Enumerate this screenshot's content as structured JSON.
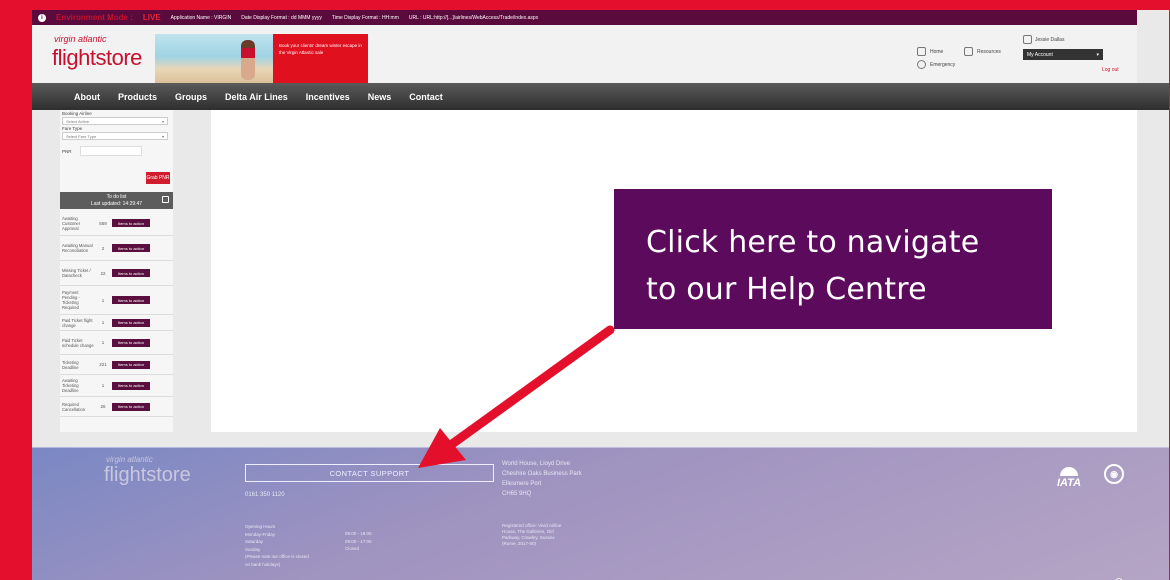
{
  "env_bar": {
    "mode": "Environment Mode :",
    "live": "LIVE",
    "app_name": "Application Name : VIRGIN",
    "date_format": "Date Display Format : dd MMM yyyy",
    "time_format": "Time Display Format : HH:mm",
    "url": "URL : URL:http://[...]/airlines/WebAccess/Trade/index.aspx"
  },
  "header": {
    "logo_small": "virgin atlantic",
    "logo_main": "flightstore",
    "banner_text": "Book your clients' dream winter escape in the Virgin Atlantic sale",
    "home": "Home",
    "resources": "Resources",
    "emergency": "Emergency",
    "user_name": "Jessie Dallas",
    "my_account": "My Account",
    "logout": "Log out"
  },
  "nav": {
    "items": [
      "About",
      "Products",
      "Groups",
      "Delta Air Lines",
      "Incentives",
      "News",
      "Contact"
    ]
  },
  "sidebar": {
    "booking_airline_label": "Booking Airline",
    "booking_airline_value": "Select Airline",
    "fare_type_label": "Fare Type",
    "fare_type_value": "Select Fare Type",
    "pnr_label": "PNR",
    "grab_pnr": "Grab PNR",
    "todo_title": "To do list",
    "todo_updated": "Last updated: 14:29:47",
    "todo_items": [
      {
        "name": "Awaiting Customer Approval",
        "count": "559",
        "action": "Items to action"
      },
      {
        "name": "Awaiting Manual Reconciliation",
        "count": "2",
        "action": "Items to action"
      },
      {
        "name": "Missing Ticket / Datacheck",
        "count": "22",
        "action": "Items to action"
      },
      {
        "name": "Payment Pending - Ticketing Required",
        "count": "1",
        "action": "Items to action"
      },
      {
        "name": "Paid Ticket flight change",
        "count": "1",
        "action": "Items to action"
      },
      {
        "name": "Paid Ticket schedule change",
        "count": "1",
        "action": "Items to action"
      },
      {
        "name": "Ticketing Deadline",
        "count": "221",
        "action": "Items to action"
      },
      {
        "name": "Awaiting Ticketing Deadline",
        "count": "1",
        "action": "Items to action"
      },
      {
        "name": "Required Cancellation",
        "count": "26",
        "action": "Items to action"
      }
    ]
  },
  "callout": {
    "line1": "Click here to navigate",
    "line2": "to our Help Centre"
  },
  "footer": {
    "logo_small": "virgin atlantic",
    "logo_main": "flightstore",
    "contact_support": "CONTACT SUPPORT",
    "phone": "0161 350 1120",
    "address_lines": [
      "World House, Lloyd Drive",
      "Cheshire Oaks Business Park",
      "Ellesmere Port",
      "CH65 9HQ"
    ],
    "hours_lines": [
      "Opening Hours",
      "Monday-Friday",
      "Saturday",
      "Sunday",
      "(Please note our office is closed",
      "on bank holidays)"
    ],
    "hours_times": [
      "09:00 - 18:00",
      "09:00 - 17:00",
      "Closed"
    ],
    "office_lines": [
      "Registered office: Vivid Airline",
      "House, The Galleries, Old",
      "Parkway, Crawley, Sussex",
      "(Rome, 2017-50)"
    ],
    "iata": "IATA"
  },
  "colors": {
    "brand_red": "#e30f2c",
    "callout_purple": "#5c0a5c",
    "nav_dark": "#3a3a3a"
  }
}
